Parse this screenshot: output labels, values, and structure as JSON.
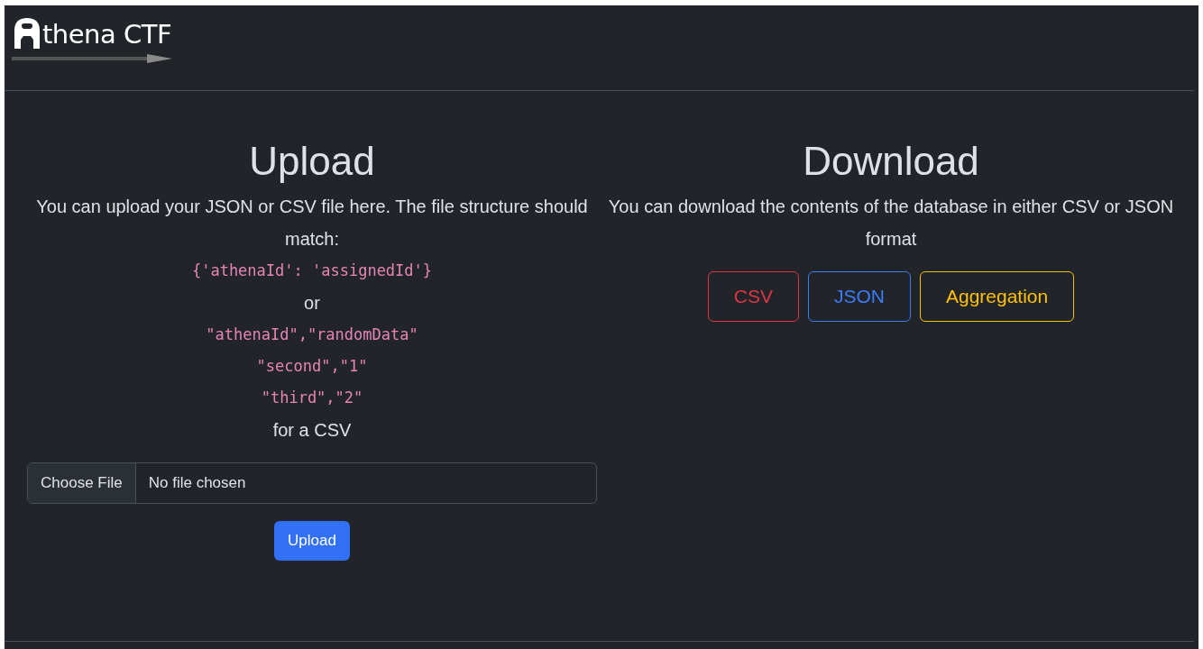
{
  "brand": {
    "text": "thena CTF"
  },
  "upload": {
    "title": "Upload",
    "intro": "You can upload your JSON or CSV file here. The file structure should match:",
    "lines": [
      {
        "kind": "code",
        "text": "{'athenaId': 'assignedId'}"
      },
      {
        "kind": "text",
        "text": "or"
      },
      {
        "kind": "code",
        "text": "\"athenaId\",\"randomData\""
      },
      {
        "kind": "code",
        "text": "\"second\",\"1\""
      },
      {
        "kind": "code",
        "text": "\"third\",\"2\""
      },
      {
        "kind": "text",
        "text": "for a CSV"
      }
    ],
    "file_input": {
      "button": "Choose File",
      "value": "No file chosen"
    },
    "button": "Upload"
  },
  "download": {
    "title": "Download",
    "intro": "You can download the contents of the database in either CSV or JSON format",
    "buttons": [
      {
        "label": "CSV",
        "color": "#dc3545"
      },
      {
        "label": "JSON",
        "color": "#3d7bf7"
      },
      {
        "label": "Aggregation",
        "color": "#ffc107"
      }
    ]
  }
}
